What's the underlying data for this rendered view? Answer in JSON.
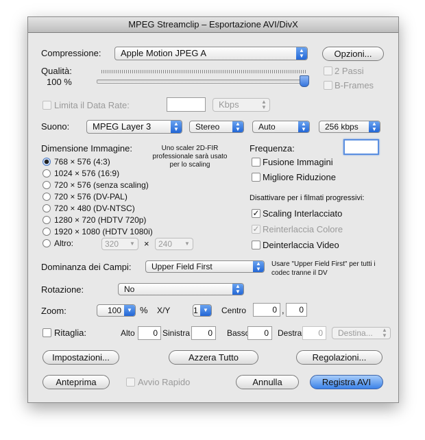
{
  "window": {
    "title": "MPEG Streamclip – Esportazione AVI/DivX"
  },
  "compression": {
    "label": "Compressione:",
    "value": "Apple Motion JPEG A",
    "options_button": "Opzioni..."
  },
  "quality": {
    "label": "Qualità:",
    "value_text": "100 %",
    "level_percent": 100
  },
  "two_pass": {
    "label": "2 Passi",
    "checked": false
  },
  "bframes": {
    "label": "B-Frames",
    "checked": false
  },
  "data_rate": {
    "label": "Limita il Data Rate:",
    "value": "",
    "unit": "Kbps"
  },
  "audio": {
    "label": "Suono:",
    "codec": "MPEG Layer 3",
    "channels": "Stereo",
    "rate": "Auto",
    "bitrate": "256 kbps"
  },
  "image_size": {
    "label": "Dimensione Immagine:",
    "note": "Uno scaler 2D-FIR professionale sarà usato per lo scaling",
    "options": [
      {
        "label": "768 × 576  (4:3)",
        "selected": true
      },
      {
        "label": "1024 × 576  (16:9)",
        "selected": false
      },
      {
        "label": "720 × 576  (senza scaling)",
        "selected": false
      },
      {
        "label": "720 × 576  (DV-PAL)",
        "selected": false
      },
      {
        "label": "720 × 480  (DV-NTSC)",
        "selected": false
      },
      {
        "label": "1280 × 720  (HDTV 720p)",
        "selected": false
      },
      {
        "label": "1920 × 1080  (HDTV 1080i)",
        "selected": false
      }
    ],
    "other_label": "Altro:",
    "other_width": "320",
    "times": "×",
    "other_height": "240"
  },
  "frequency": {
    "label": "Frequenza:",
    "value": ""
  },
  "frame_blending": {
    "label": "Fusione Immagini",
    "checked": false
  },
  "better_downscaling": {
    "label": "Migliore Riduzione",
    "checked": false
  },
  "progressive": {
    "label": "Disattivare per i filmati progressivi:",
    "interlaced_scaling": {
      "label": "Scaling Interlacciato",
      "checked": true
    },
    "reinterlace_chroma": {
      "label": "Reinterlaccia Colore",
      "checked": true
    },
    "deinterlace_video": {
      "label": "Deinterlaccia Video",
      "checked": false
    }
  },
  "field_dominance": {
    "label": "Dominanza dei Campi:",
    "value": "Upper Field First",
    "note": "Usare \"Upper Field First\" per tutti i codec tranne il DV"
  },
  "rotation": {
    "label": "Rotazione:",
    "value": "No"
  },
  "zoom": {
    "label": "Zoom:",
    "value": "100",
    "percent": "%",
    "xy_label": "X/Y",
    "xy_value": "1",
    "center_label": "Centro",
    "center_x": "0",
    "comma": ",",
    "center_y": "0"
  },
  "crop": {
    "label": "Ritaglia:",
    "top_label": "Alto",
    "top": "0",
    "left_label": "Sinistra",
    "left": "0",
    "bottom_label": "Basso",
    "bottom": "0",
    "right_label": "Destra",
    "right": "0",
    "destination": "Destina..."
  },
  "buttons": {
    "settings": "Impostazioni...",
    "reset_all": "Azzera Tutto",
    "adjustments": "Regolazioni...",
    "preview": "Anteprima",
    "fast_start": "Avvio Rapido",
    "cancel": "Annulla",
    "save": "Registra AVI"
  }
}
